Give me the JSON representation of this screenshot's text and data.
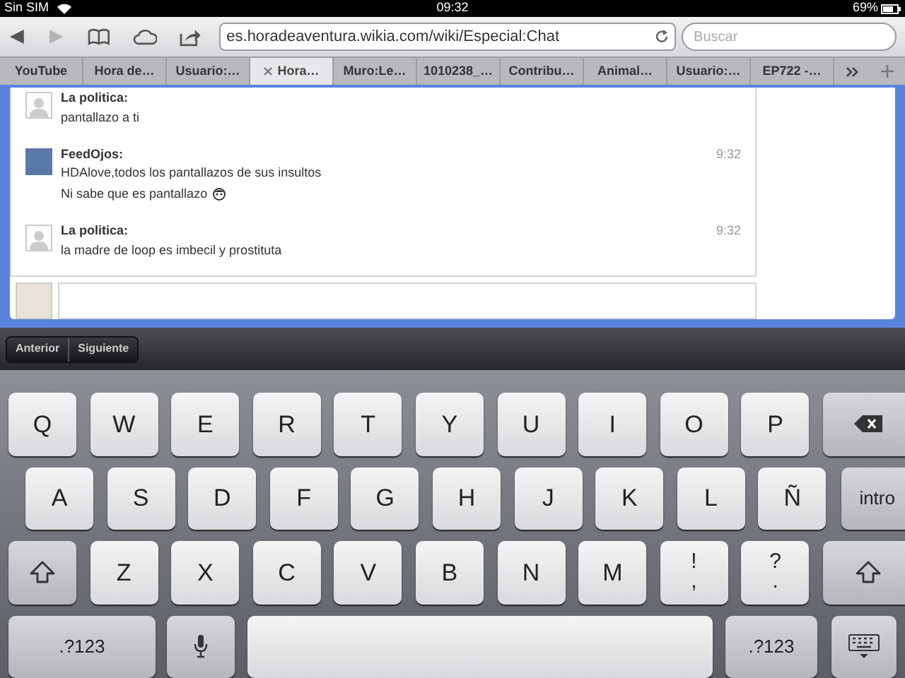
{
  "status_bar": {
    "carrier": "Sin SIM",
    "time": "09:32",
    "battery": "69%"
  },
  "toolbar": {
    "url": "es.horadeaventura.wikia.com/wiki/Especial:Chat",
    "search": {
      "placeholder": "Buscar"
    }
  },
  "tabs": [
    {
      "label": "YouTube",
      "selected": false
    },
    {
      "label": "Hora de…",
      "selected": false
    },
    {
      "label": "Usuario:…",
      "selected": false
    },
    {
      "label": "Hora…",
      "selected": true
    },
    {
      "label": "Muro:Le…",
      "selected": false
    },
    {
      "label": "1010238_…",
      "selected": false
    },
    {
      "label": "Contribu…",
      "selected": false
    },
    {
      "label": "Animal…",
      "selected": false
    },
    {
      "label": "Usuario:…",
      "selected": false
    },
    {
      "label": "EP722 -…",
      "selected": false
    }
  ],
  "chat": {
    "messages": [
      {
        "kind": "silhouette",
        "user": "La politica:",
        "lines": [
          "pantallazo a ti"
        ]
      },
      {
        "kind": "picture",
        "user": "FeedOjos:",
        "time": "9:32",
        "lines": [
          "HDAlove,todos los pantallazos de sus insultos",
          "Ni sabe que es pantallazo"
        ]
      },
      {
        "kind": "silhouette",
        "user": "La politica:",
        "time": "9:32",
        "lines": [
          "la madre de loop es imbecil y prostituta"
        ]
      }
    ]
  },
  "form_bar": {
    "buttons": [
      "Anterior",
      "Siguiente"
    ]
  },
  "keyboard": {
    "rows": [
      {
        "keys": [
          {
            "kind": "key",
            "label": "Q"
          },
          {
            "kind": "key",
            "label": "W"
          },
          {
            "kind": "key",
            "label": "E"
          },
          {
            "kind": "key",
            "label": "R"
          },
          {
            "kind": "key",
            "label": "T"
          },
          {
            "kind": "key",
            "label": "Y"
          },
          {
            "kind": "key",
            "label": "U"
          },
          {
            "kind": "key",
            "label": "I"
          },
          {
            "kind": "key",
            "label": "O"
          },
          {
            "kind": "key",
            "label": "P"
          },
          {
            "kind": "backspace"
          }
        ]
      },
      {
        "keys": [
          {
            "kind": "key",
            "label": "A"
          },
          {
            "kind": "key",
            "label": "S"
          },
          {
            "kind": "key",
            "label": "D"
          },
          {
            "kind": "key",
            "label": "F"
          },
          {
            "kind": "key",
            "label": "G"
          },
          {
            "kind": "key",
            "label": "H"
          },
          {
            "kind": "key",
            "label": "J"
          },
          {
            "kind": "key",
            "label": "K"
          },
          {
            "kind": "key",
            "label": "L"
          },
          {
            "kind": "key",
            "label": "Ñ"
          },
          {
            "kind": "return",
            "label": "intro"
          }
        ]
      },
      {
        "keys": [
          {
            "kind": "shift"
          },
          {
            "kind": "key",
            "label": "Z"
          },
          {
            "kind": "key",
            "label": "X"
          },
          {
            "kind": "key",
            "label": "C"
          },
          {
            "kind": "key",
            "label": "V"
          },
          {
            "kind": "key",
            "label": "B"
          },
          {
            "kind": "key",
            "label": "N"
          },
          {
            "kind": "key",
            "label": "M"
          },
          {
            "kind": "punct",
            "label": "!",
            "sub": ","
          },
          {
            "kind": "punct",
            "label": "?",
            "sub": "."
          },
          {
            "kind": "shift"
          }
        ]
      },
      {
        "keys": [
          {
            "kind": "switch",
            "label": ".?123"
          },
          {
            "kind": "mic"
          },
          {
            "kind": "space"
          },
          {
            "kind": "switch",
            "label": ".?123"
          },
          {
            "kind": "dismiss"
          }
        ]
      }
    ]
  }
}
